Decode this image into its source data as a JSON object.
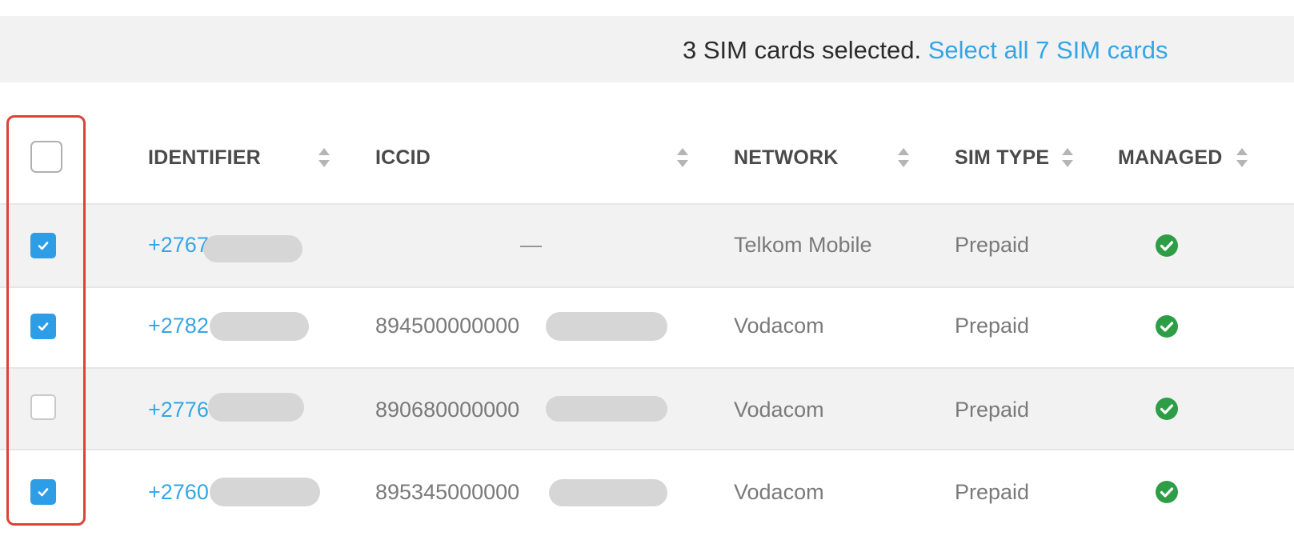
{
  "banner": {
    "selected_text": "3 SIM cards selected.",
    "select_all_link": "Select all 7 SIM cards"
  },
  "table": {
    "columns": [
      {
        "key": "identifier",
        "label": "IDENTIFIER"
      },
      {
        "key": "iccid",
        "label": "ICCID"
      },
      {
        "key": "network",
        "label": "NETWORK"
      },
      {
        "key": "sim_type",
        "label": "SIM TYPE"
      },
      {
        "key": "managed",
        "label": "MANAGED"
      }
    ],
    "select_all_checked": false,
    "rows": [
      {
        "checked": true,
        "identifier": "+2767",
        "iccid": "—",
        "network": "Telkom Mobile",
        "sim_type": "Prepaid",
        "managed": true
      },
      {
        "checked": true,
        "identifier": "+2782",
        "iccid": "894500000000",
        "network": "Vodacom",
        "sim_type": "Prepaid",
        "managed": true
      },
      {
        "checked": false,
        "identifier": "+2776",
        "iccid": "890680000000",
        "network": "Vodacom",
        "sim_type": "Prepaid",
        "managed": true
      },
      {
        "checked": true,
        "identifier": "+2760",
        "iccid": "895345000000",
        "network": "Vodacom",
        "sim_type": "Prepaid",
        "managed": true
      }
    ]
  },
  "colors": {
    "link": "#34a6e6",
    "checkbox_checked": "#2d9ee6",
    "managed_check": "#2e9e46",
    "highlight_border": "#d9433a"
  },
  "icons": {
    "sort": "sort-arrows-icon",
    "checkmark": "checkmark-icon",
    "managed": "check-circle-icon"
  }
}
